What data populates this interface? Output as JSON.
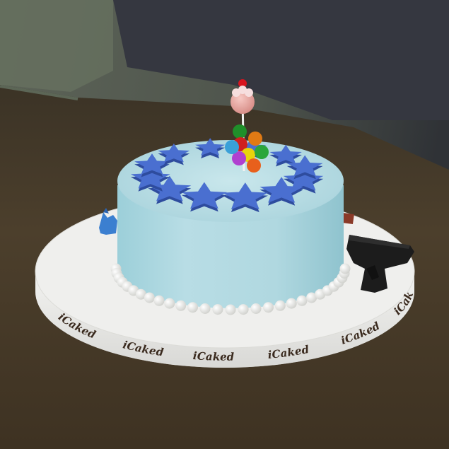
{
  "scene": {
    "subject": "cake",
    "icons": [
      "cake-icon",
      "star-icon",
      "pistol-icon",
      "lollipop-icon",
      "balloon-icon",
      "dog-figure-icon"
    ]
  },
  "board": {
    "brand_text": "iCaked",
    "brand_repeats": 6
  },
  "decorations": {
    "star_count": 12,
    "balloon_colors": [
      "#1f8f2a",
      "#e07a14",
      "#d02020",
      "#e8d40c",
      "#2aa63a",
      "#b040d0",
      "#3aa0d8",
      "#e8601c"
    ],
    "pearl_color": "#f4f4f2",
    "star_color": "#4a6fd0",
    "icing_color": "#b7dbe3",
    "board_color": "#ececea"
  }
}
